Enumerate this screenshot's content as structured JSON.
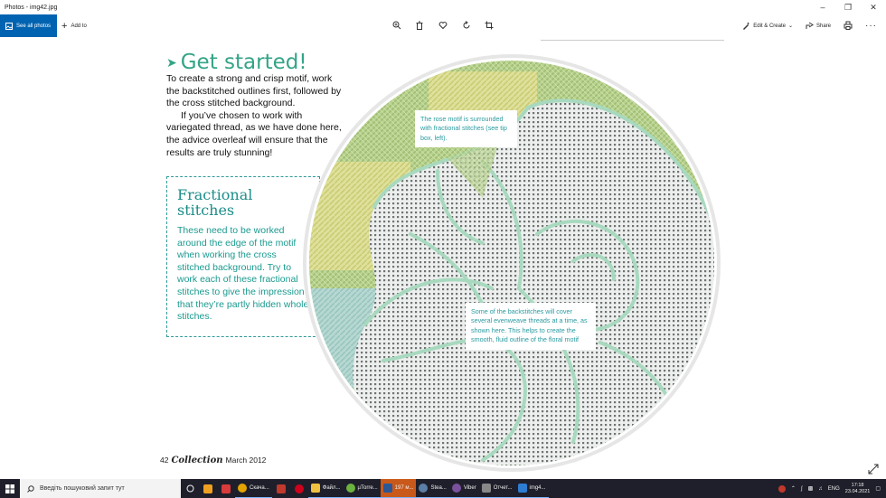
{
  "window": {
    "title": "Photos - img42.jpg"
  },
  "toolbar": {
    "see_all": "See all photos",
    "add_to": "Add to",
    "edit_create": "Edit & Create",
    "share": "Share"
  },
  "page": {
    "get_started_title": "Get started!",
    "get_started_p1": "To create a strong and crisp motif, work the backstitched outlines first, followed by the cross stitched background.",
    "get_started_p2": "If you’ve chosen to work with variegated thread, as we have done here, the advice overleaf will ensure that the results are truly stunning!",
    "fractional_title_1": "Fractional",
    "fractional_title_2": "stitches",
    "fractional_body": "These need to be worked around the edge of the motif when working the cross stitched background. Try to work each of these fractional stitches to give the impression that they’re partly hidden whole stitches.",
    "callout_1": "The rose motif is surrounded with fractional stitches (see tip box, left).",
    "callout_2": "Some of the backstitches will cover several evenweave threads at a time, as shown here. This helps to create the smooth, fluid outline of the floral motif",
    "footer_page": "42",
    "footer_mag": "Collection",
    "footer_date": "March 2012"
  },
  "taskbar": {
    "search_placeholder": "Введіть пошуковий запит тут",
    "apps": [
      {
        "label": "Скача...",
        "color": "#e4a400"
      },
      {
        "label": "Файл...",
        "color": "#f0c040"
      },
      {
        "label": "µTorre...",
        "color": "#6cb33f"
      },
      {
        "label": "197 м...",
        "color": "#2b5797"
      },
      {
        "label": "Stea...",
        "color": "#1b2838"
      },
      {
        "label": "Viber",
        "color": "#7b519d"
      },
      {
        "label": "Отчет...",
        "color": "#444444"
      },
      {
        "label": "img4...",
        "color": "#2d7dd2"
      }
    ],
    "lang": "ENG",
    "time": "17:18",
    "date": "23.04.2021"
  },
  "colors": {
    "accent_blue": "#0063b1",
    "teal_title": "#34a487",
    "teal_text": "#1a9a8f",
    "taskbar_bg": "#1f1f2b"
  }
}
